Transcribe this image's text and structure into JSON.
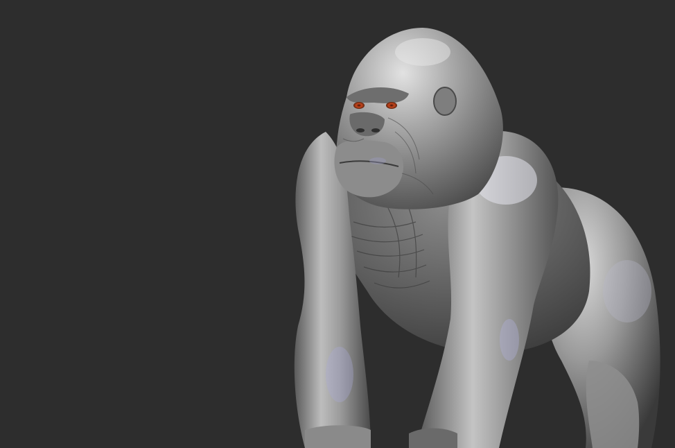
{
  "viewport": {
    "background_color": "#2d2d2d",
    "subject": "gorilla-sculpt",
    "material": "grey-clay",
    "eye_color": "#c8461c"
  }
}
